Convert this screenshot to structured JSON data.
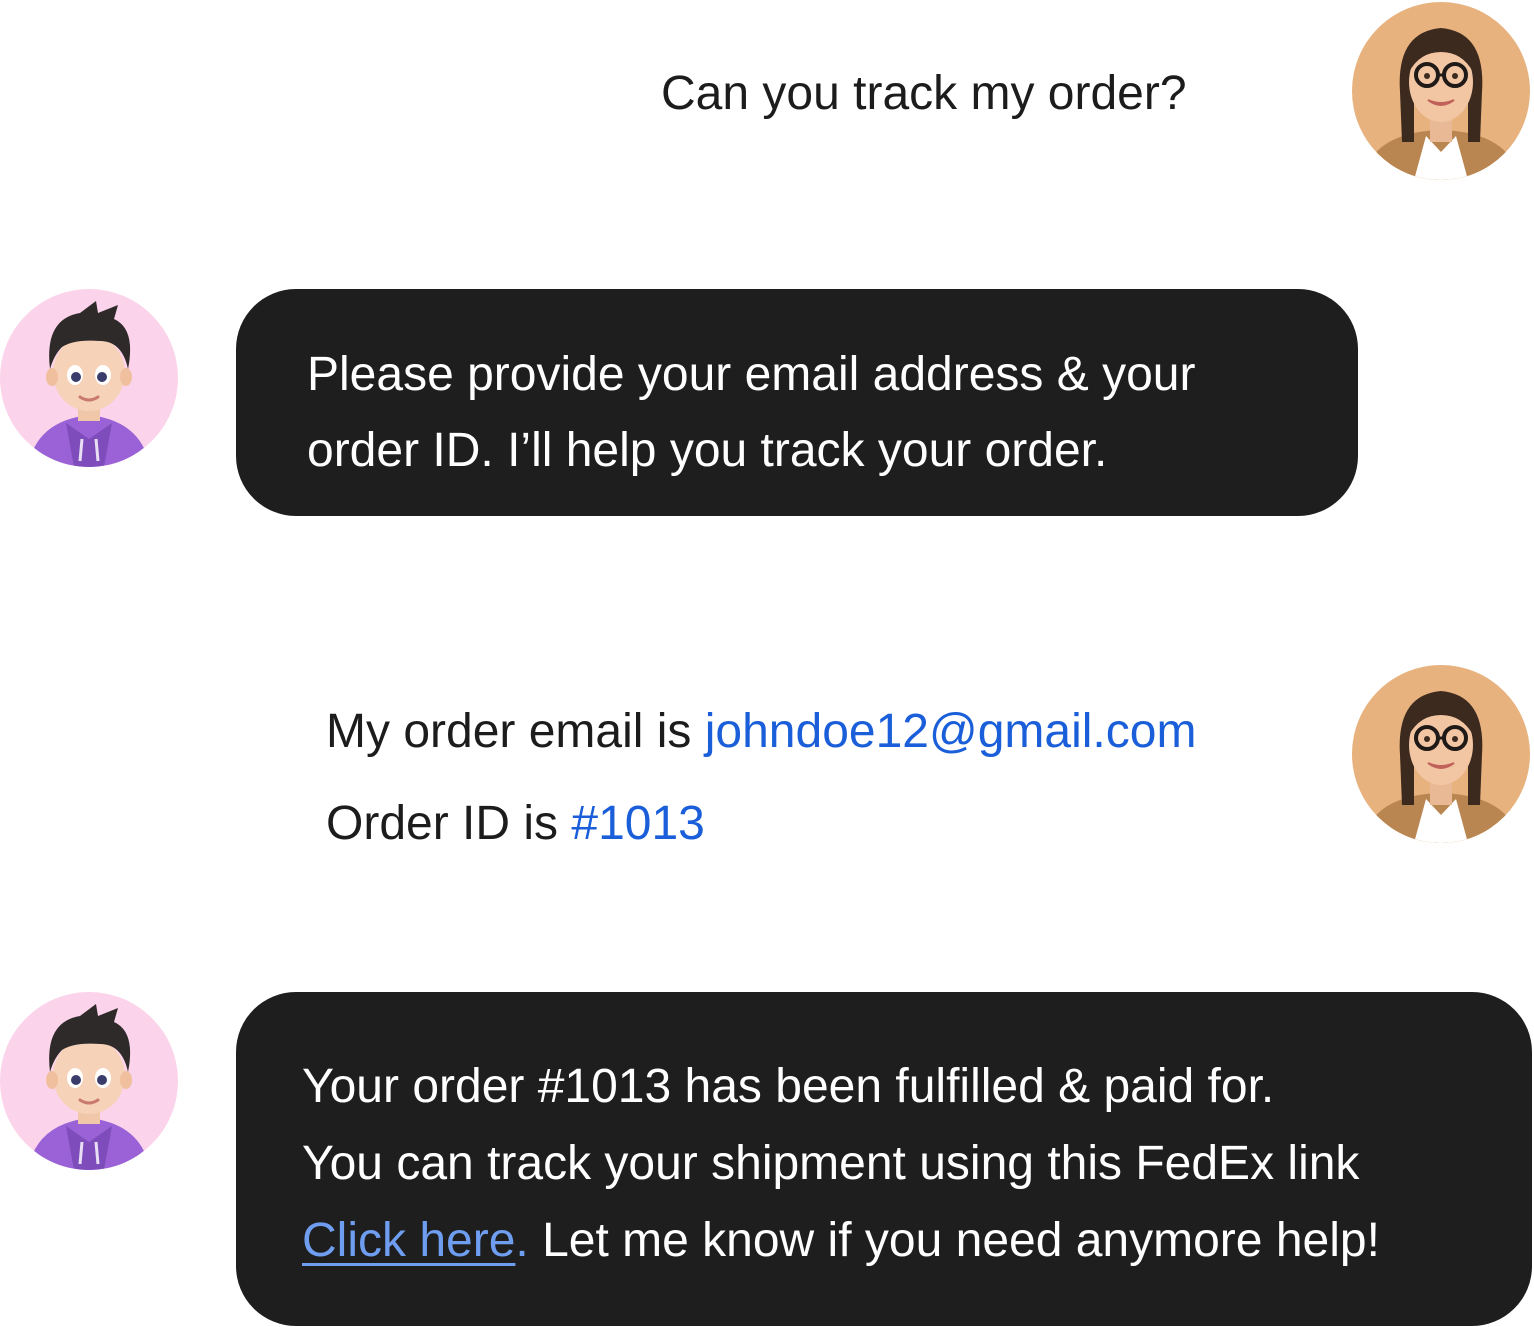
{
  "colors": {
    "bot_bubble": "#1e1e1e",
    "user_avatar_bg": "#e7b27e",
    "bot_avatar_bg": "#fbd3ea",
    "highlight_blue": "#1a5fd9",
    "link_blue": "#6f9ef0"
  },
  "icons": {
    "user_avatar": "woman-with-glasses-avatar",
    "bot_avatar": "cartoon-boy-purple-hoodie-avatar"
  },
  "messages": [
    {
      "sender": "user",
      "text": "Can you track my order?"
    },
    {
      "sender": "bot",
      "line1": "Please provide your email address & your",
      "line2": "order ID. I’ll help you track your order."
    },
    {
      "sender": "user",
      "email_prefix": "My order email is ",
      "email": "johndoe12@gmail.com",
      "order_prefix": "Order ID is ",
      "order_id": "#1013"
    },
    {
      "sender": "bot",
      "line1": "Your order #1013 has been fulfilled & paid for.",
      "line2": "You can track your shipment using this FedEx link",
      "link_text": "Click here",
      "link_suffix": ".",
      "line3_rest": " Let me know if you need anymore help!"
    }
  ]
}
